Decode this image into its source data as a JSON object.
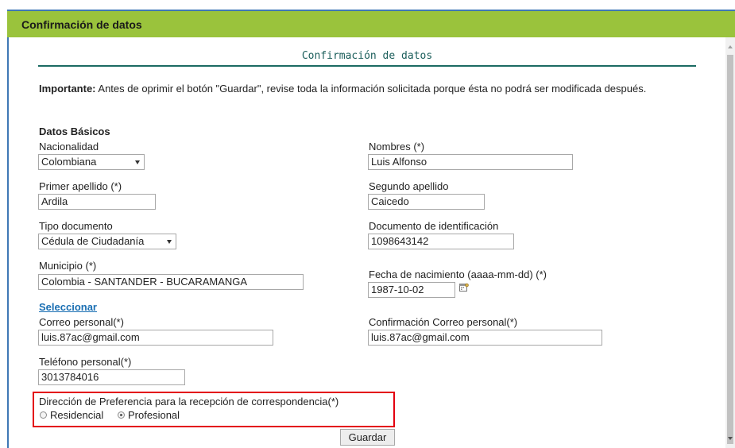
{
  "header": {
    "title": "Confirmación de datos"
  },
  "form": {
    "subtitle": "Confirmación de datos",
    "important_label": "Importante:",
    "important_text": " Antes de oprimir el botón \"Guardar\", revise toda la información solicitada porque ésta no podrá ser modificada después.",
    "section_title": "Datos Básicos",
    "nacionalidad": {
      "label": "Nacionalidad",
      "value": "Colombiana"
    },
    "nombres": {
      "label": "Nombres (*)",
      "value": "Luis Alfonso"
    },
    "primer_apellido": {
      "label": "Primer apellido (*)",
      "value": "Ardila"
    },
    "segundo_apellido": {
      "label": "Segundo apellido",
      "value": "Caicedo"
    },
    "tipo_documento": {
      "label": "Tipo documento",
      "value": "Cédula de Ciudadanía"
    },
    "documento": {
      "label": "Documento de identificación",
      "value": "1098643142"
    },
    "municipio": {
      "label": "Municipio (*)",
      "value": "Colombia - SANTANDER - BUCARAMANGA"
    },
    "fecha_nacimiento": {
      "label": "Fecha de nacimiento (aaaa-mm-dd) (*)",
      "value": "1987-10-02"
    },
    "seleccionar_link": "Seleccionar",
    "correo": {
      "label": "Correo personal(*)",
      "value": "luis.87ac@gmail.com"
    },
    "confirmacion_correo": {
      "label": "Confirmación Correo personal(*)",
      "value": "luis.87ac@gmail.com"
    },
    "telefono": {
      "label": "Teléfono personal(*)",
      "value": "3013784016"
    },
    "direccion": {
      "label": "Dirección de Preferencia para la recepción de correspondencia(*)",
      "options": [
        "Residencial",
        "Profesional"
      ],
      "selected": "Profesional"
    },
    "save_button": "Guardar"
  },
  "colors": {
    "header_bg": "#9ac33c",
    "highlight_border": "#e3000f",
    "link": "#1a6fb3",
    "subtitle": "#1b5e5b"
  }
}
